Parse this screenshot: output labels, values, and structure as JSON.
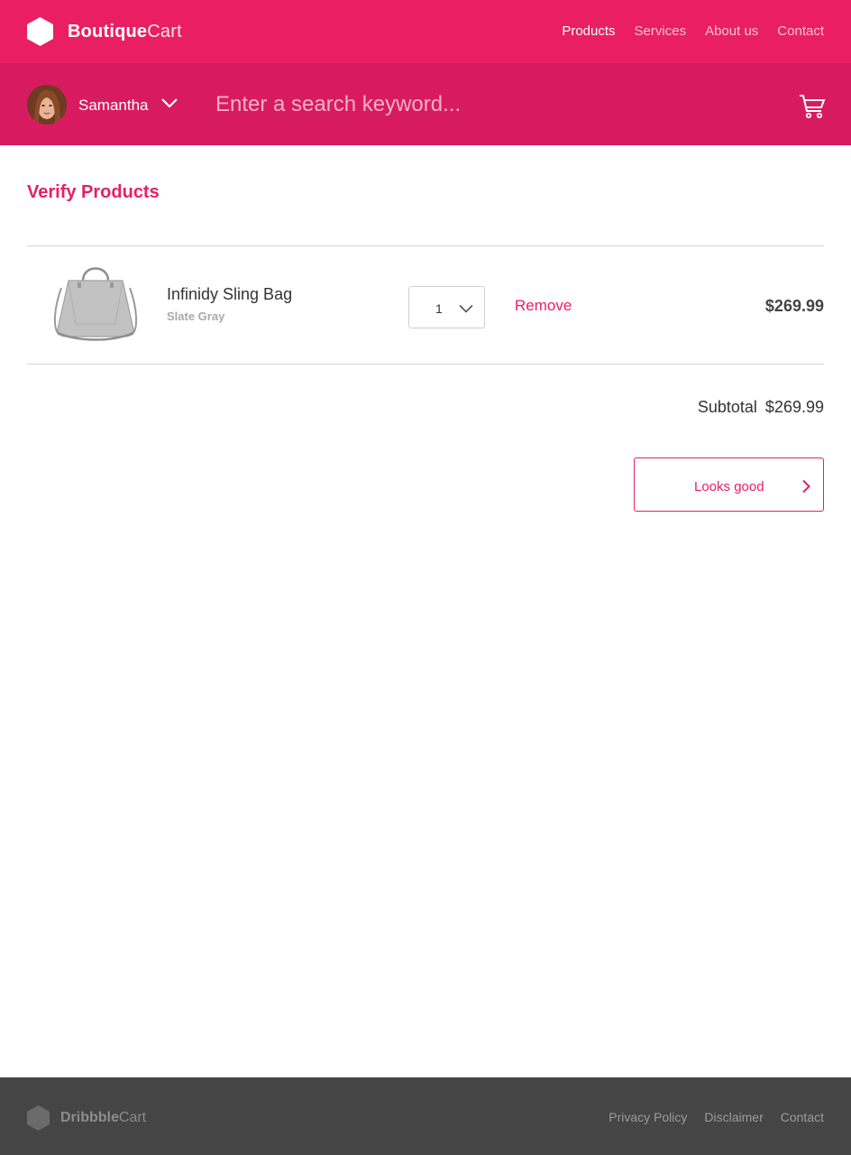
{
  "brand": {
    "name_bold": "Boutique",
    "name_light": "Cart"
  },
  "nav": {
    "items": [
      {
        "label": "Products",
        "active": true
      },
      {
        "label": "Services",
        "active": false
      },
      {
        "label": "About us",
        "active": false
      },
      {
        "label": "Contact",
        "active": false
      }
    ]
  },
  "user": {
    "name": "Samantha"
  },
  "search": {
    "placeholder": "Enter a search keyword..."
  },
  "page": {
    "title": "Verify Products"
  },
  "cart": {
    "items": [
      {
        "name": "Infinidy Sling Bag",
        "variant": "Slate Gray",
        "quantity": "1",
        "remove_label": "Remove",
        "price": "$269.99"
      }
    ],
    "subtotal_label": "Subtotal",
    "subtotal_value": "$269.99",
    "confirm_label": "Looks good"
  },
  "footer": {
    "brand_bold": "Dribbble",
    "brand_light": "Cart",
    "links": [
      "Privacy Policy",
      "Disclaimer",
      "Contact"
    ]
  },
  "colors": {
    "primary": "#e91e63",
    "primary_dark": "#d81b60",
    "footer_bg": "#454545"
  },
  "icons": {
    "logo": "hexagon-icon",
    "user_menu": "chevron-down-icon",
    "cart": "shopping-cart-icon",
    "qty_menu": "chevron-down-icon",
    "confirm": "chevron-right-icon"
  }
}
